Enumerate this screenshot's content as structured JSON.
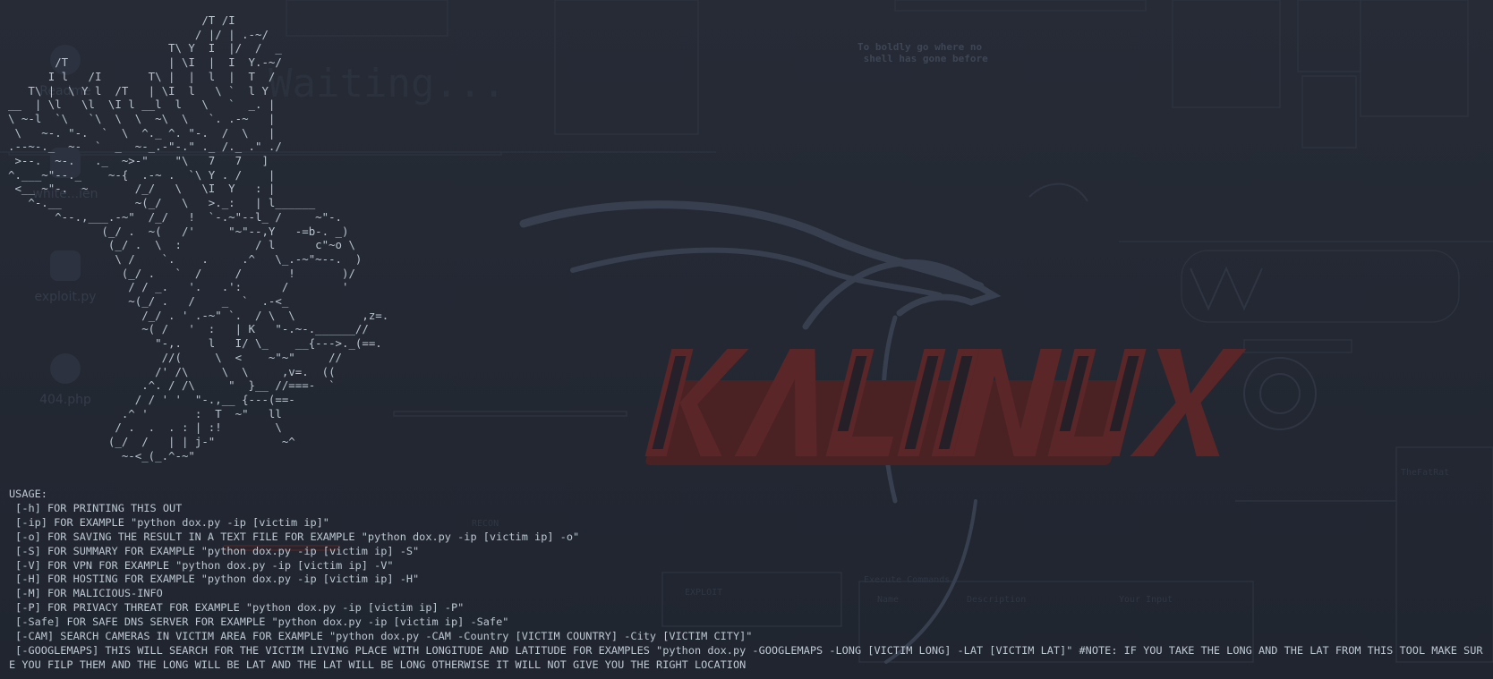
{
  "wallpaper": {
    "colors": {
      "background": "#232833",
      "logo_red": "#5a2628",
      "logo_dark": "#1b1f28",
      "dragon": "#394150",
      "ascii_faint": "#303744"
    },
    "logo_text": "KALI LINUX",
    "quote": "To boldly go where no\n shell has gone before",
    "faint_labels": {
      "waiting": "Waiting...",
      "recon": "RECON",
      "exploit": "EXPLOIT",
      "fatrat": "TheFatRat",
      "execute": "Execute Commands",
      "name_col": "Name",
      "desc_col": "Description",
      "your_input": "Your Input"
    },
    "desktop_icons": [
      {
        "name": "readme",
        "label": "Readme",
        "icon": "chrome-icon"
      },
      {
        "name": "whitelist",
        "label": "white...ien",
        "icon": "file-icon"
      },
      {
        "name": "exploit",
        "label": "exploit.py",
        "icon": "python-icon"
      },
      {
        "name": "404",
        "label": "404.php",
        "icon": "browser-icon"
      }
    ]
  },
  "terminal": {
    "text_color": "#bcc8d2",
    "ascii_art": "                             /T /I\n                            / |/ | .-~/\n                        T\\ Y  I  |/  /  _\n       /T               | \\I  |  I  Y.-~/\n      I l   /I       T\\ |  |  l  |  T  /\n   T\\ |  \\ Y l  /T   | \\I  l   \\ `  l Y\n__  | \\l   \\l  \\I l __l  l   \\   `  _. |\n\\ ~-l  `\\   `\\  \\  \\  ~\\  \\   `. .-~   |\n \\   ~-. \"-.  `  \\  ^._ ^. \"-.  /  \\   |\n.--~-._  ~-  `  _  ~-_.-\"-.\" ._ /._ .\" ./\n >--.  ~-.   ._  ~>-\"    \"\\   7   7   ]\n^.___~\"--._    ~-{  .-~ .  `\\ Y . /    |\n <__ ~\"-.  ~       /_/   \\   \\I  Y   : |\n   ^-.__           ~(_/   \\   >._:   | l______\n       ^--.,___.-~\"  /_/   !  `-.~\"--l_ /     ~\"-.\n              (_/ .  ~(   /'     \"~\"--,Y   -=b-. _)\n               (_/ .  \\  :           / l      c\"~o \\\n                \\ /    `.    .     .^   \\_.-~\"~--.  )\n                 (_/ .   `  /     /       !       )/\n                  / / _.   '.   .':      /        '\n                  ~(_/ .   /    _  `  .-<_\n                    /_/ . ' .-~\" `.  / \\  \\          ,z=.\n                    ~( /   '  :   | K   \"-.~-.______//\n                      \"-,.    l   I/ \\_    __{--->._(==.\n                       //(     \\  <    ~\"~\"     //\n                      /' /\\     \\  \\     ,v=.  ((\n                    .^. / /\\     \"  }__ //===-  `\n                   / / ' '  \"-.,__ {---(==-\n                 .^ '       :  T  ~\"   ll\n                / .  .  . : | :!        \\\n               (_/  /   | | j-\"          ~^\n                 ~-<_(_.^-~\"",
    "usage_lines": [
      "USAGE:",
      " [-h] FOR PRINTING THIS OUT",
      " [-ip] FOR EXAMPLE \"python dox.py -ip [victim ip]\"",
      " [-o] FOR SAVING THE RESULT IN A TEXT FILE FOR EXAMPLE \"python dox.py -ip [victim ip] -o\"",
      " [-S] FOR SUMMARY FOR EXAMPLE \"python dox.py -ip [victim ip] -S\"",
      " [-V] FOR VPN FOR EXAMPLE \"python dox.py -ip [victim ip] -V\"",
      " [-H] FOR HOSTING FOR EXAMPLE \"python dox.py -ip [victim ip] -H\"",
      " [-M] FOR MALICIOUS-INFO",
      " [-P] FOR PRIVACY THREAT FOR EXAMPLE \"python dox.py -ip [victim ip] -P\"",
      " [-Safe] FOR SAFE DNS SERVER FOR EXAMPLE \"python dox.py -ip [victim ip] -Safe\"",
      " [-CAM] SEARCH CAMERAS IN VICTIM AREA FOR EXAMPLE \"python dox.py -CAM -Country [VICTIM COUNTRY] -City [VICTIM CITY]\"",
      " [-GOOGLEMAPS] THIS WILL SEARCH FOR THE VICTIM LIVING PLACE WITH LONGITUDE AND LATITUDE FOR EXAMPLES \"python dox.py -GOOGLEMAPS -LONG [VICTIM LONG] -LAT [VICTIM LAT]\" #NOTE: IF YOU TAKE THE LONG AND THE LAT FROM THIS TOOL MAKE SURE YOU FILP THEM AND THE LONG WILL BE LAT AND THE LAT WILL BE LONG OTHERWISE IT WILL NOT GIVE YOU THE RIGHT LOCATION"
    ]
  }
}
